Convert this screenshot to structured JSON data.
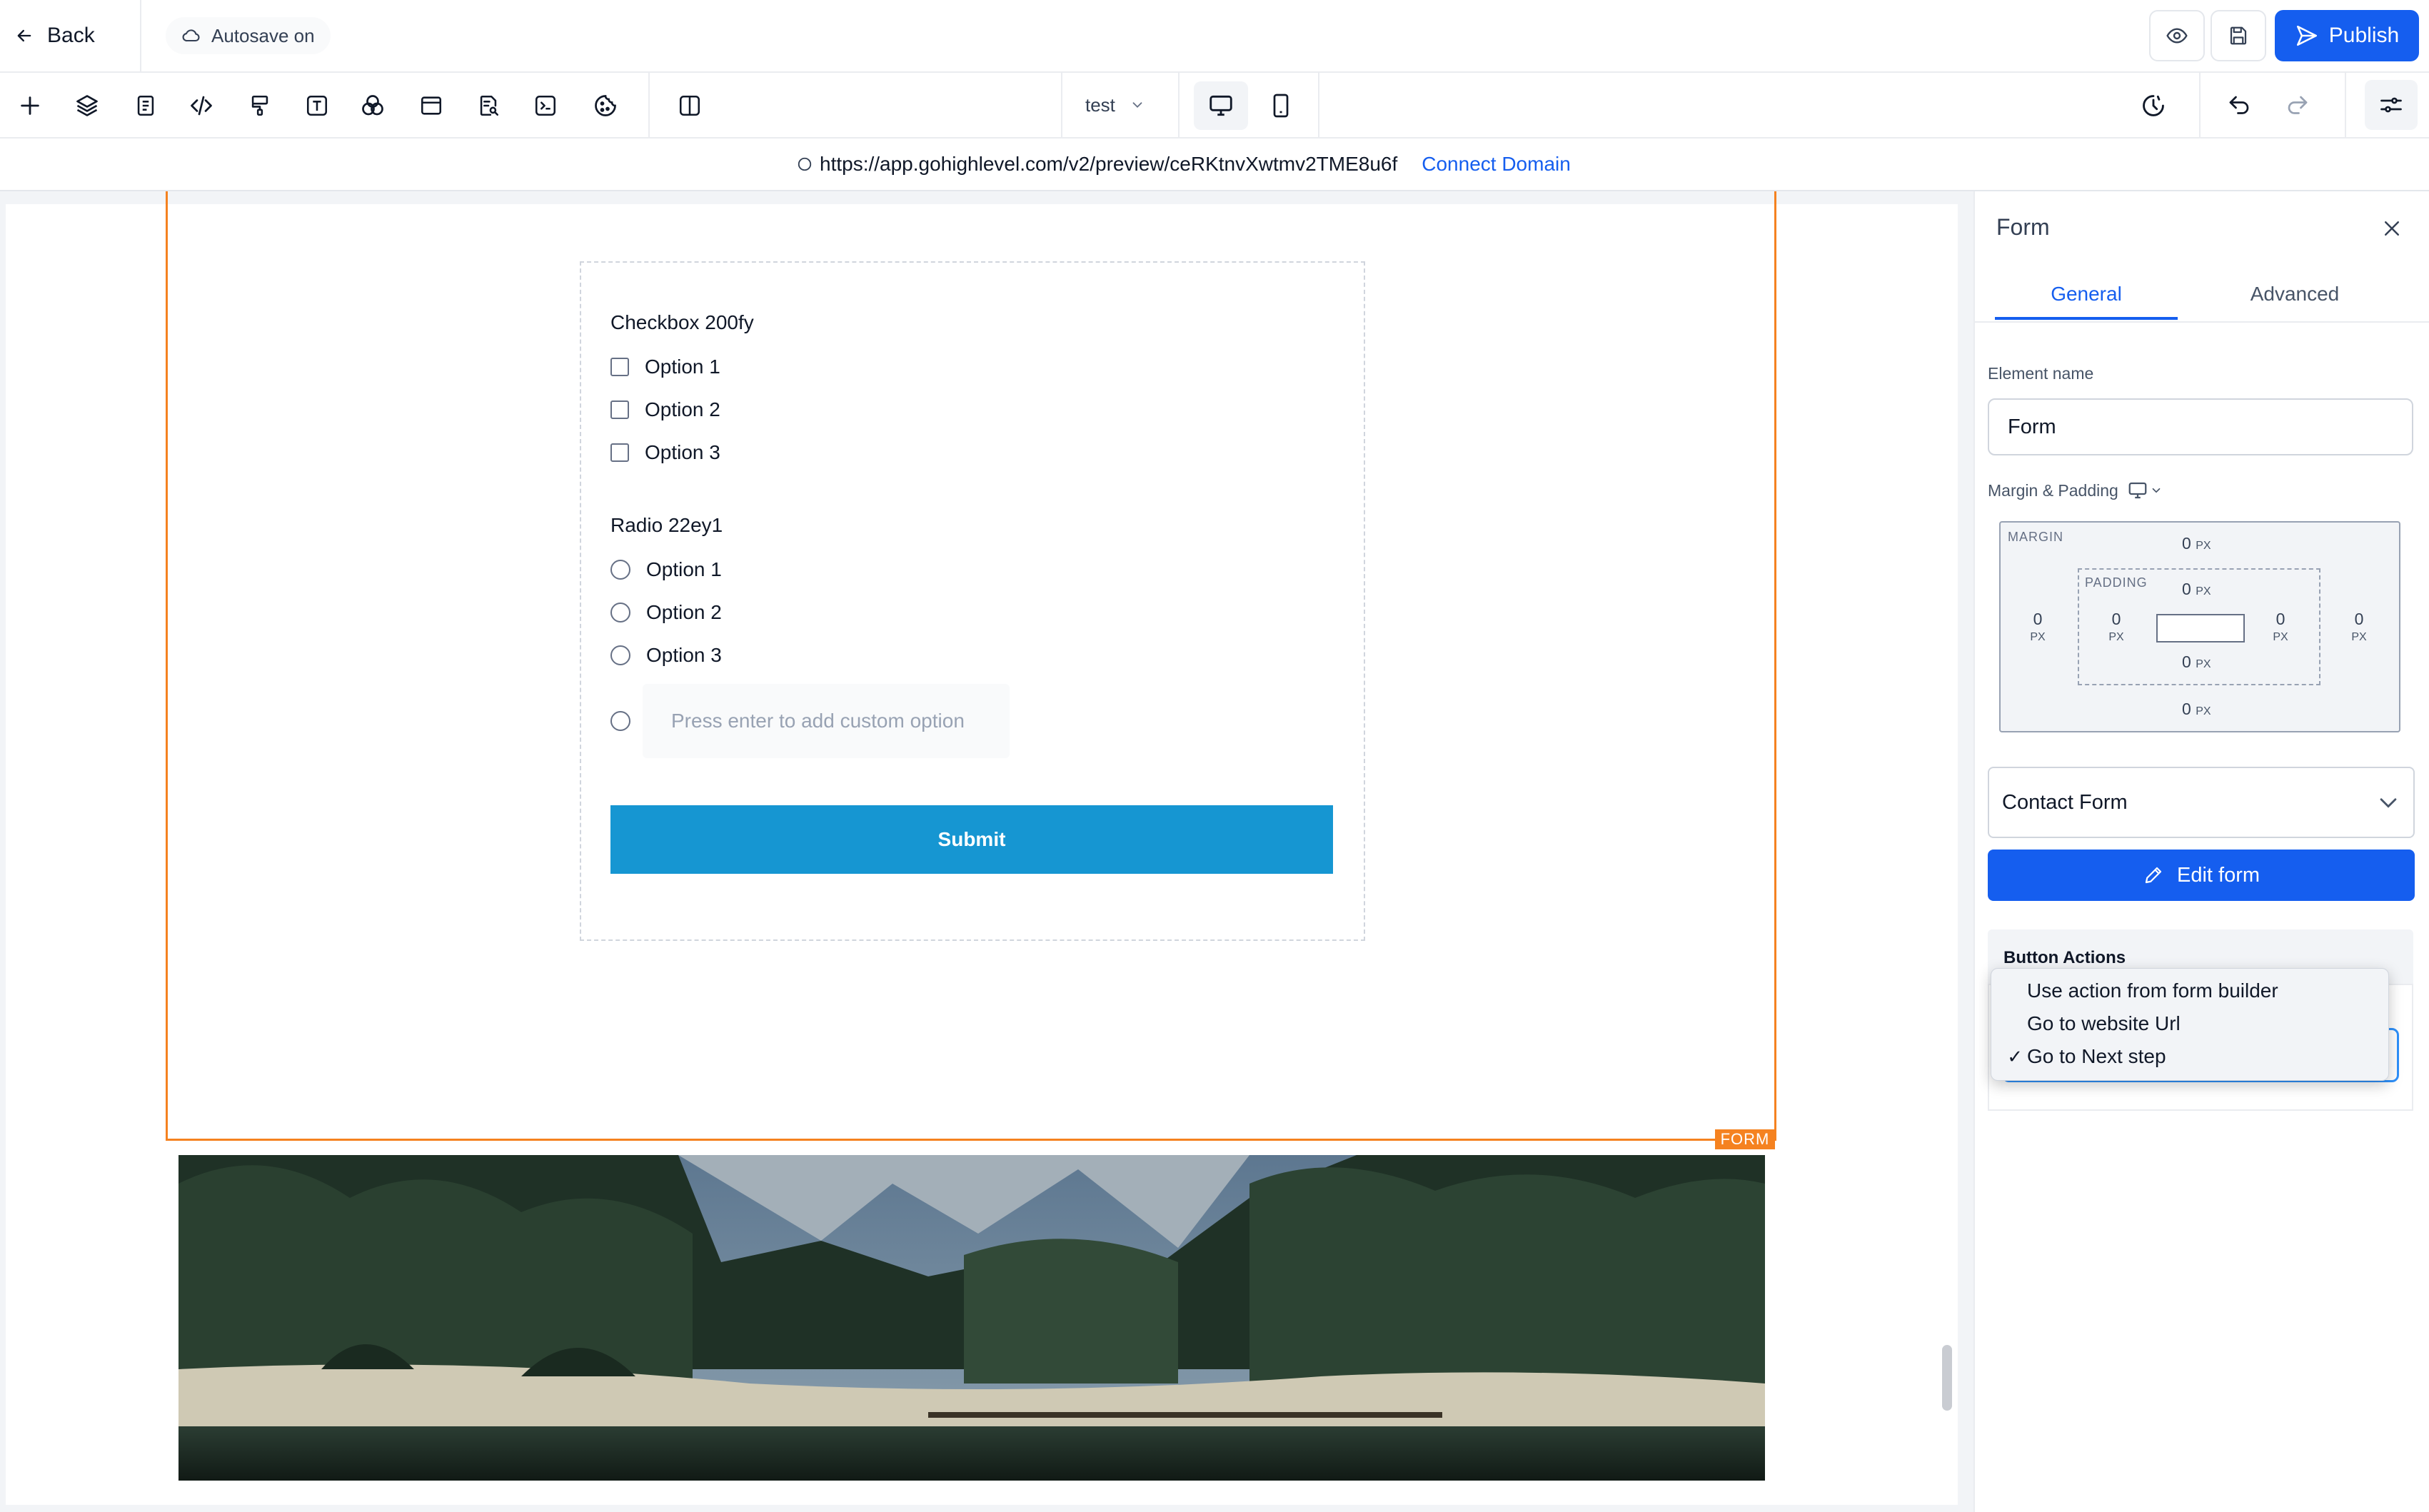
{
  "header": {
    "back_label": "Back",
    "autosave_label": "Autosave on",
    "publish_label": "Publish"
  },
  "toolbar": {
    "tools": [
      "add-icon",
      "layers-icon",
      "page-icon",
      "code-icon",
      "paint-roller-icon",
      "text-icon",
      "shapes-icon",
      "browser-icon",
      "search-page-icon",
      "terminal-icon",
      "cookie-icon",
      "split-view-icon"
    ],
    "page_select": "test",
    "right_tools": [
      "history-icon",
      "undo-icon",
      "redo-icon",
      "settings-sliders-icon"
    ]
  },
  "url_bar": {
    "url": "https://app.gohighlevel.com/v2/preview/ceRKtnvXwtmv2TME8u6f",
    "connect_domain": "Connect Domain"
  },
  "canvas": {
    "form_tag": "FORM",
    "checkbox_field": {
      "label": "Checkbox 200fy",
      "options": [
        "Option 1",
        "Option 2",
        "Option 3"
      ]
    },
    "radio_field": {
      "label": "Radio 22ey1",
      "options": [
        "Option 1",
        "Option 2",
        "Option 3"
      ],
      "custom_placeholder": "Press enter to add custom option"
    },
    "submit_label": "Submit"
  },
  "panel": {
    "title": "Form",
    "tabs": [
      "General",
      "Advanced"
    ],
    "active_tab": "General",
    "element_name_label": "Element name",
    "element_name_value": "Form",
    "margin_padding_label": "Margin & Padding",
    "margin_caption": "MARGIN",
    "padding_caption": "PADDING",
    "unit": "PX",
    "margin": {
      "top": "0",
      "right": "0",
      "bottom": "0",
      "left": "0"
    },
    "padding": {
      "top": "0",
      "right": "0",
      "bottom": "0",
      "left": "0"
    },
    "form_select_value": "Contact Form",
    "edit_form_label": "Edit form",
    "button_actions_label": "Button Actions",
    "action_options": [
      "Use action from form builder",
      "Go to website Url",
      "Go to Next step"
    ],
    "selected_action": "Go to Next step",
    "check_mark": "✓"
  },
  "colors": {
    "accent": "#155eef",
    "selection_outline": "#f58220",
    "submit": "#1696d2"
  }
}
